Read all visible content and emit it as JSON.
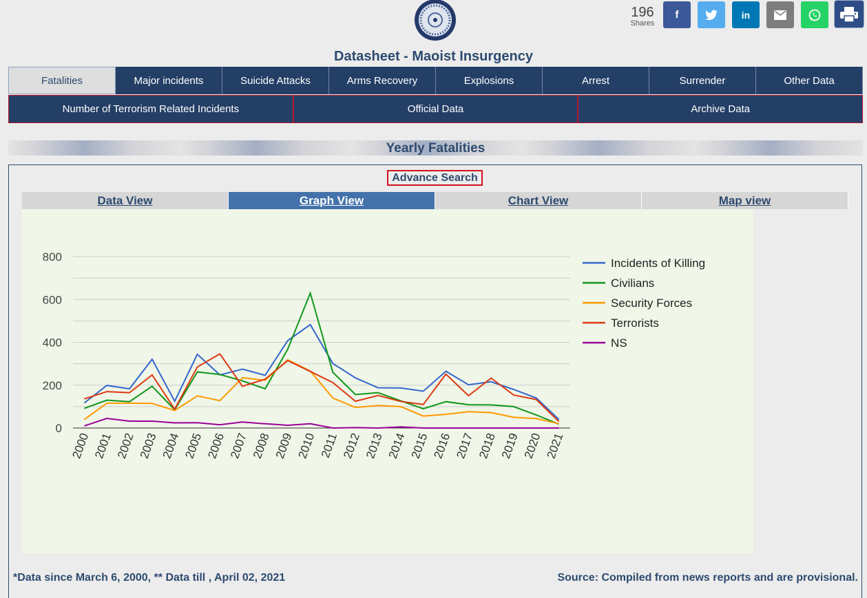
{
  "share": {
    "count": "196",
    "label": "Shares"
  },
  "social_icons": [
    "facebook-icon",
    "twitter-icon",
    "linkedin-icon",
    "email-icon",
    "whatsapp-icon"
  ],
  "colors": {
    "facebook": "#3b5998",
    "twitter": "#55acee",
    "linkedin": "#0077b5",
    "email": "#7d7d7d",
    "whatsapp": "#25d366",
    "nav": "#243f66",
    "accent": "#2d4a6f"
  },
  "page_title": "Datasheet - Maoist Insurgency",
  "nav_tabs": [
    "Fatalities",
    "Major incidents",
    "Suicide Attacks",
    "Arms Recovery",
    "Explosions",
    "Arrest",
    "Surrender",
    "Other Data"
  ],
  "sub_tabs": [
    "Number of Terrorism Related Incidents",
    "Official Data",
    "Archive Data"
  ],
  "section_title": "Yearly Fatalities",
  "advance_search": "Advance Search",
  "view_tabs": [
    "Data View",
    "Graph View",
    "Chart View",
    "Map view"
  ],
  "chart_data": {
    "type": "line",
    "x": [
      "2000",
      "2001",
      "2002",
      "2003",
      "2004",
      "2005",
      "2006",
      "2007",
      "2008",
      "2009",
      "2010",
      "2011",
      "2012",
      "2013",
      "2014",
      "2015",
      "2016",
      "2017",
      "2018",
      "2019",
      "2020",
      "2021"
    ],
    "ylim": [
      0,
      800
    ],
    "yticks": [
      "0",
      "200",
      "400",
      "600",
      "800"
    ],
    "legend_position": "right",
    "series": [
      {
        "name": "Incidents of Killing",
        "color": "#3366cc",
        "values": [
          117,
          199,
          183,
          321,
          125,
          344,
          248,
          275,
          246,
          408,
          483,
          301,
          234,
          188,
          187,
          172,
          265,
          202,
          216,
          180,
          140,
          40
        ]
      },
      {
        "name": "Civilians",
        "color": "#109618",
        "values": [
          92,
          130,
          123,
          195,
          85,
          262,
          250,
          220,
          183,
          368,
          630,
          260,
          156,
          165,
          127,
          90,
          123,
          109,
          108,
          100,
          61,
          18
        ]
      },
      {
        "name": "Security Forces",
        "color": "#ff9900",
        "values": [
          40,
          116,
          116,
          115,
          82,
          150,
          128,
          235,
          223,
          318,
          266,
          140,
          96,
          105,
          100,
          56,
          64,
          76,
          72,
          50,
          44,
          20
        ]
      },
      {
        "name": "Terrorists",
        "color": "#dc3912",
        "values": [
          136,
          170,
          165,
          248,
          88,
          285,
          346,
          195,
          228,
          315,
          264,
          212,
          125,
          152,
          124,
          110,
          252,
          151,
          233,
          154,
          133,
          30
        ]
      },
      {
        "name": "NS",
        "color": "#990099",
        "values": [
          10,
          45,
          32,
          32,
          24,
          25,
          15,
          28,
          20,
          13,
          20,
          0,
          2,
          0,
          5,
          0,
          0,
          0,
          0,
          0,
          0,
          0
        ]
      }
    ]
  },
  "footer_left": "*Data since March 6, 2000, ** Data till , April 02, 2021",
  "footer_right": "Source: Compiled from news reports and are provisional."
}
